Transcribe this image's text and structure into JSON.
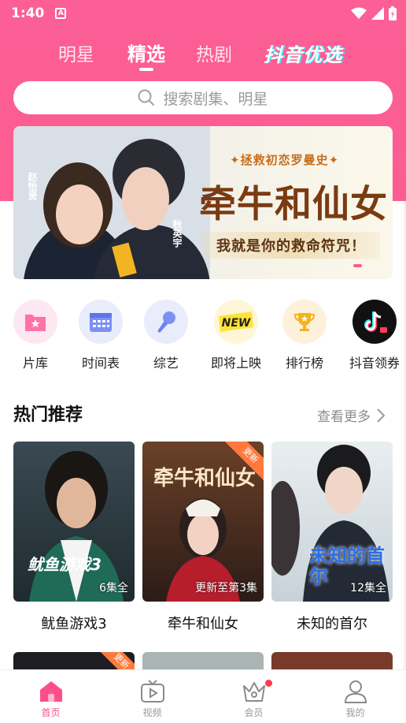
{
  "status": {
    "time": "1:40",
    "a_badge": "A"
  },
  "tabs": [
    {
      "label": "明星"
    },
    {
      "label": "精选"
    },
    {
      "label": "热剧"
    }
  ],
  "brand_tab": "抖音优选",
  "search": {
    "placeholder": "搜索剧集、明星"
  },
  "banner": {
    "tag": "✦拯救初恋罗曼史✦",
    "title": "牵牛和仙女",
    "subtitle": "我就是你的救命符咒！",
    "name_left": "赵怡贤",
    "name_right": "秋英宇"
  },
  "quick": [
    {
      "label": "片库",
      "icon": "film-folder-icon"
    },
    {
      "label": "时间表",
      "icon": "calendar-icon"
    },
    {
      "label": "综艺",
      "icon": "microphone-icon"
    },
    {
      "label": "即将上映",
      "icon": "new-badge-icon",
      "badge": "NEW"
    },
    {
      "label": "排行榜",
      "icon": "trophy-icon"
    },
    {
      "label": "抖音领券",
      "icon": "douyin-coupon-icon"
    }
  ],
  "section": {
    "title": "热门推荐",
    "more": "查看更多"
  },
  "cards": [
    {
      "name": "鱿鱼游戏3",
      "ep": "6集全",
      "poster_text": "鱿鱼游戏3"
    },
    {
      "name": "牵牛和仙女",
      "ep": "更新至第3集",
      "poster_text": "牵牛和仙女",
      "corner": "更新"
    },
    {
      "name": "未知的首尔",
      "ep": "12集全",
      "poster_text": "未知的首尔"
    }
  ],
  "row2_corner": "更新",
  "nav": [
    {
      "label": "首页",
      "icon": "home-icon"
    },
    {
      "label": "视频",
      "icon": "tv-play-icon"
    },
    {
      "label": "会员",
      "icon": "crown-icon"
    },
    {
      "label": "我的",
      "icon": "user-icon"
    }
  ],
  "colors": {
    "brand_pink": "#fd5d93",
    "active_nav": "#ff4f8b"
  }
}
